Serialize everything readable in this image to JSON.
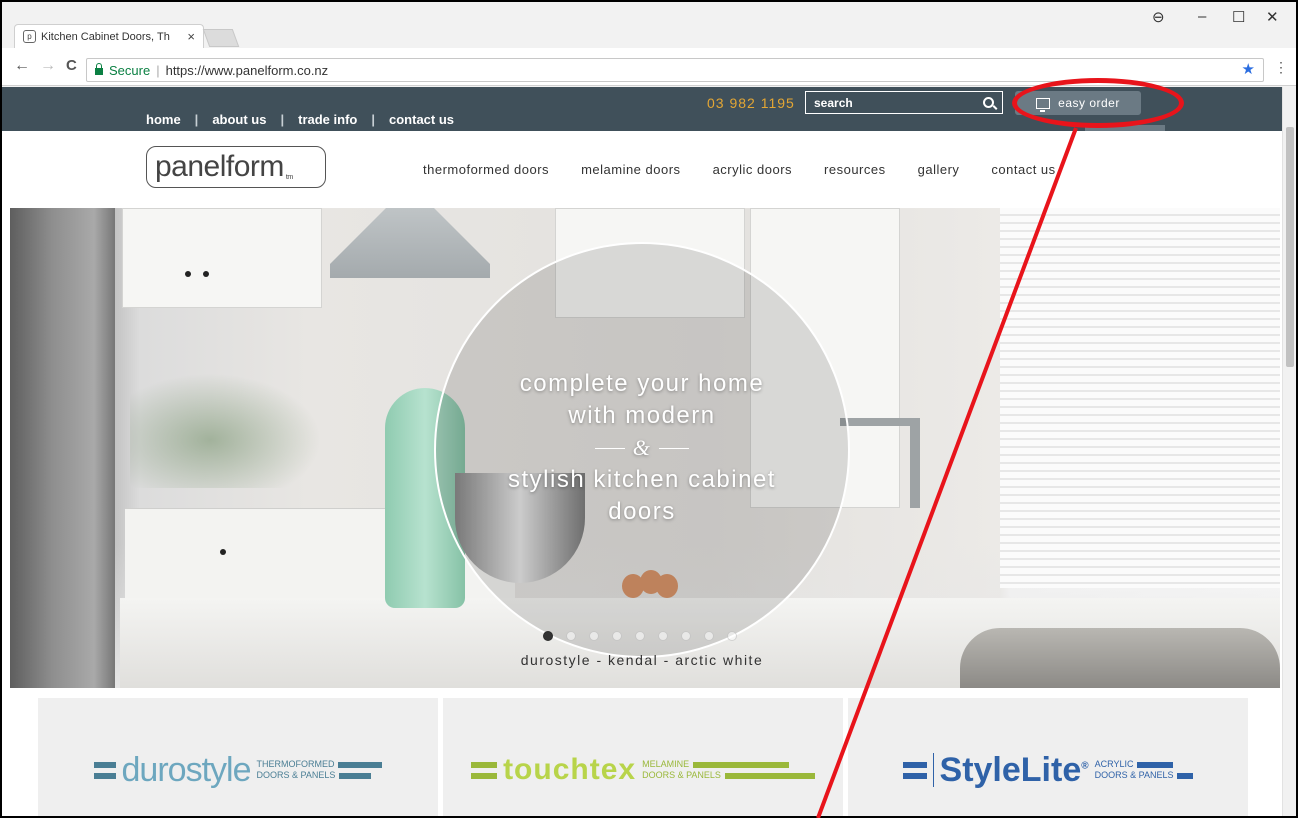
{
  "browser": {
    "tab_title": "Kitchen Cabinet Doors, Th",
    "tab_close": "×",
    "favicon": "p",
    "window_controls": {
      "account": "⊖",
      "minimize": "–",
      "maximize": "☐",
      "close": "✕"
    },
    "nav": {
      "back": "←",
      "forward": "→",
      "reload": "C"
    },
    "secure_label": "Secure",
    "url": "https://www.panelform.co.nz",
    "bookmark_icon": "★",
    "menu_icon": "⋮"
  },
  "topbar": {
    "links": [
      "home",
      "about us",
      "trade info",
      "contact us"
    ],
    "phone": "03 982 1195",
    "search_placeholder": "search",
    "easy_order_label": "easy order"
  },
  "header": {
    "logo_text": "panelform",
    "logo_tm": "tm",
    "nav": [
      "thermoformed doors",
      "melamine doors",
      "acrylic doors",
      "resources",
      "gallery",
      "contact us"
    ]
  },
  "hero": {
    "line1": "complete your home",
    "line2": "with modern",
    "amp": "&",
    "line3": "stylish kitchen cabinet",
    "line4": "doors",
    "caption": "durostyle - kendal - arctic white",
    "slide_count": 9,
    "active_slide": 1
  },
  "brands": [
    {
      "name": "durostyle",
      "sub1": "THERMOFORMED",
      "sub2": "DOORS & PANELS",
      "color": "#4a7e94"
    },
    {
      "name": "touchtex",
      "sub1": "MELAMINE",
      "sub2": "DOORS & PANELS",
      "color": "#9ab83a"
    },
    {
      "name": "StyleLite",
      "reg": "®",
      "sub1": "ACRYLIC",
      "sub2": "DOORS & PANELS",
      "color": "#2f62a8"
    }
  ],
  "colors": {
    "topbar": "#40505a",
    "phone": "#e3a634",
    "annotation": "#e8141b"
  }
}
